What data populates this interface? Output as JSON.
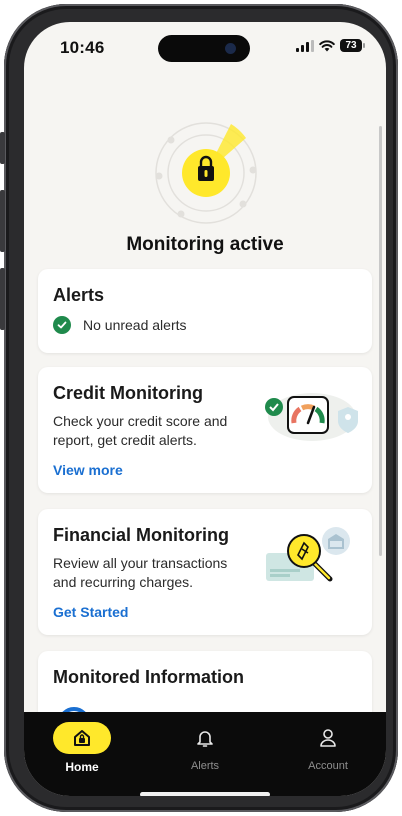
{
  "status_bar": {
    "time": "10:46",
    "battery": "73"
  },
  "hero": {
    "title": "Monitoring active",
    "icon": "shield-lock-icon"
  },
  "alerts_card": {
    "title": "Alerts",
    "status": "No unread alerts",
    "status_icon": "check-circle-icon"
  },
  "credit_card": {
    "title": "Credit Monitoring",
    "description": "Check your credit score and report, get credit alerts.",
    "link": "View more",
    "illustration": "credit-gauge-icon"
  },
  "financial_card": {
    "title": "Financial Monitoring",
    "description": "Review all your transactions and recurring charges.",
    "link": "Get Started",
    "illustration": "magnifier-card-icon"
  },
  "monitored_card": {
    "title": "Monitored Information"
  },
  "tab_bar": {
    "tabs": [
      {
        "label": "Home",
        "icon": "home-shield-icon",
        "active": true
      },
      {
        "label": "Alerts",
        "icon": "bell-icon",
        "active": false
      },
      {
        "label": "Account",
        "icon": "person-icon",
        "active": false
      }
    ]
  },
  "colors": {
    "accent": "#ffe82b",
    "link": "#1a6fd1",
    "success": "#1f8a4c",
    "background": "#f6f5f2"
  }
}
